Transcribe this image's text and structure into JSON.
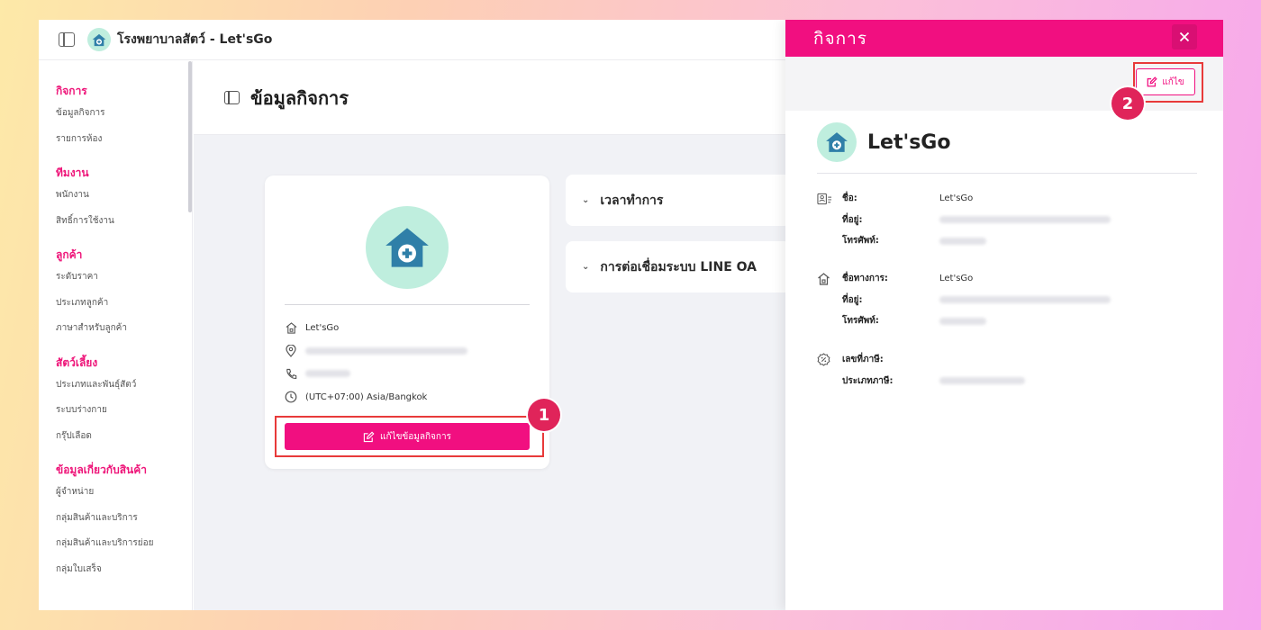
{
  "app": {
    "title": "โรงพยาบาลสัตว์ - Let'sGo"
  },
  "sidebar": {
    "groups": [
      {
        "title": "กิจการ",
        "items": [
          "ข้อมูลกิจการ",
          "รายการห้อง"
        ]
      },
      {
        "title": "ทีมงาน",
        "items": [
          "พนักงาน",
          "สิทธิ์การใช้งาน"
        ]
      },
      {
        "title": "ลูกค้า",
        "items": [
          "ระดับราคา",
          "ประเภทลูกค้า",
          "ภาษาสำหรับลูกค้า"
        ]
      },
      {
        "title": "สัตว์เลี้ยง",
        "items": [
          "ประเภทและพันธุ์สัตว์",
          "ระบบร่างกาย",
          "กรุ๊ปเลือด"
        ]
      },
      {
        "title": "ข้อมูลเกี่ยวกับสินค้า",
        "items": [
          "ผู้จำหน่าย",
          "กลุ่มสินค้าและบริการ",
          "กลุ่มสินค้าและบริการย่อย",
          "กลุ่มใบเสร็จ"
        ]
      }
    ]
  },
  "main": {
    "page_title": "ข้อมูลกิจการ",
    "business": {
      "name": "Let'sGo",
      "timezone": "(UTC+07:00) Asia/Bangkok",
      "edit_button": "แก้ไขข้อมูลกิจการ"
    },
    "accordions": [
      "เวลาทำการ",
      "การต่อเชื่อมระบบ LINE OA"
    ],
    "badges": [
      "1",
      "2"
    ]
  },
  "drawer": {
    "title": "กิจการ",
    "edit_button": "แก้ไข",
    "business_name": "Let'sGo",
    "sections": [
      {
        "icon": "id-card-icon",
        "rows": [
          {
            "label": "ชื่อ:",
            "value": "Let'sGo"
          },
          {
            "label": "ที่อยู่:",
            "value": ""
          },
          {
            "label": "โทรศัพท์:",
            "value": ""
          }
        ]
      },
      {
        "icon": "building-icon",
        "rows": [
          {
            "label": "ชื่อทางการ:",
            "value": "Let'sGo"
          },
          {
            "label": "ที่อยู่:",
            "value": ""
          },
          {
            "label": "โทรศัพท์:",
            "value": ""
          }
        ]
      },
      {
        "icon": "percent-icon",
        "rows": [
          {
            "label": "เลขที่ภาษี:",
            "value": ""
          },
          {
            "label": "ประเภทภาษี:",
            "value": ""
          }
        ]
      }
    ]
  },
  "colors": {
    "accent": "#f10f80",
    "highlight": "#e83a3a",
    "avatar_bg": "#bfeede",
    "avatar_fg": "#2f7fa8"
  }
}
